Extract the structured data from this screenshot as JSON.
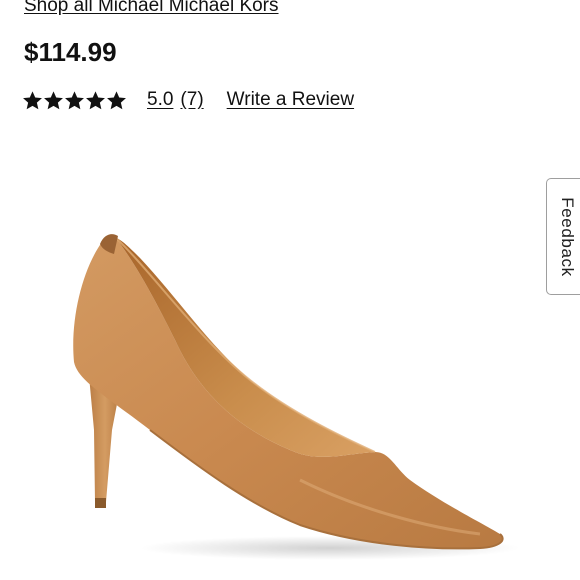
{
  "brand_link": "Shop all Michael Michael Kors",
  "price": "$114.99",
  "rating": {
    "stars": 5,
    "value": "5.0",
    "count": "(7)",
    "write_review": "Write a Review"
  },
  "feedback": {
    "label": "Feedback"
  },
  "product_image": {
    "subject": "tan leather pointed-toe pump",
    "color": "#c8884d"
  },
  "colors": {
    "text": "#111111",
    "background": "#ffffff"
  }
}
